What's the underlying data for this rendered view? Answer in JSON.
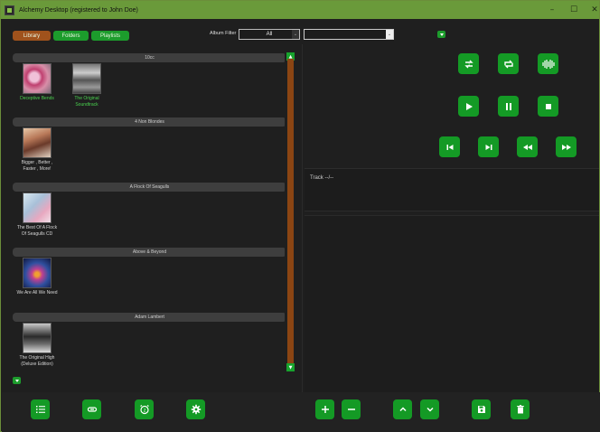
{
  "window": {
    "title": "Alchemy Desktop (registered to John Doe)",
    "controls": {
      "minimize": "–",
      "maximize": "☐",
      "close": "✕"
    }
  },
  "tabs": [
    {
      "label": "Library",
      "color": "#a0521c"
    },
    {
      "label": "Folders",
      "color": "#1c9c2c"
    },
    {
      "label": "Playlists",
      "color": "#1c9c2c"
    }
  ],
  "filter": {
    "label": "Album Filter",
    "selected": "All",
    "search_value": ""
  },
  "library": {
    "groups": [
      {
        "artist": "10cc",
        "albums": [
          {
            "title_lines": [
              "Deceptive Bends"
            ],
            "highlight": true
          },
          {
            "title_lines": [
              "The Original",
              "Soundtrack"
            ],
            "highlight": true
          }
        ]
      },
      {
        "artist": "4 Non Blondes",
        "albums": [
          {
            "title_lines": [
              "Bigger , Better ,",
              "Faster , More!"
            ],
            "highlight": false
          }
        ]
      },
      {
        "artist": "A Flock Of Seagulls",
        "albums": [
          {
            "title_lines": [
              "The Best Of A Flock",
              "Of Seagulls CD"
            ],
            "highlight": false
          }
        ]
      },
      {
        "artist": "Above & Beyond",
        "albums": [
          {
            "title_lines": [
              "We Are All We Need"
            ],
            "highlight": false
          }
        ]
      },
      {
        "artist": "Adam Lambert",
        "albums": [
          {
            "title_lines": [
              "The Original High",
              "(Deluxe Edition)"
            ],
            "highlight": false
          }
        ]
      }
    ]
  },
  "player": {
    "track_label": "Track --/--",
    "buttons": [
      "repeat-one",
      "repeat-all",
      "visualizer",
      "play",
      "pause",
      "stop",
      "previous",
      "next",
      "rewind",
      "fast-forward"
    ]
  },
  "bottom_toolbar": {
    "buttons": [
      "list",
      "link",
      "sleep-timer",
      "settings",
      "add",
      "remove",
      "move-up",
      "move-down",
      "save",
      "delete"
    ]
  },
  "colors": {
    "accent_green": "#149a25",
    "library_tab": "#a0521c",
    "scroll_thumb": "#8b4513",
    "title_bar": "#6a9a3a",
    "highlight_text": "#49d14f"
  }
}
